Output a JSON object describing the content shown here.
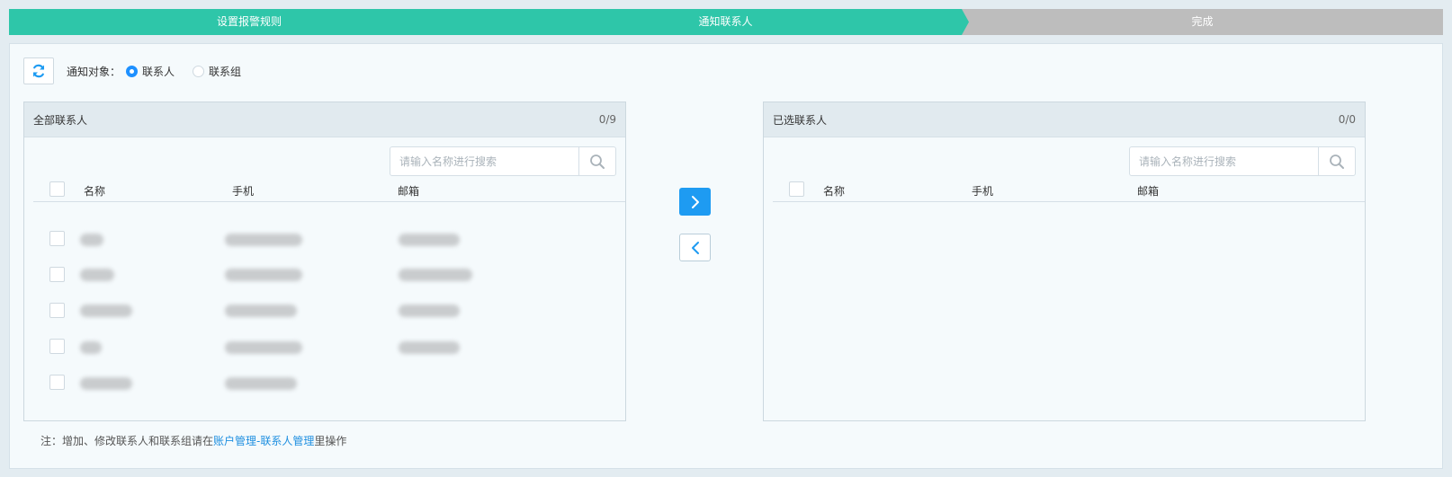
{
  "steps": [
    {
      "label": "设置报警规则",
      "state": "done",
      "color": "#2ec6a9"
    },
    {
      "label": "通知联系人",
      "state": "active",
      "color": "#2ec6a9"
    },
    {
      "label": "完成",
      "state": "pending",
      "color": "#bdbdbd"
    }
  ],
  "toolbar": {
    "refresh_icon": "refresh-icon",
    "target_label": "通知对象：",
    "options": [
      {
        "label": "联系人",
        "checked": true
      },
      {
        "label": "联系组",
        "checked": false
      }
    ]
  },
  "left_panel": {
    "title": "全部联系人",
    "count": "0/9",
    "search_placeholder": "请输入名称进行搜索",
    "columns": [
      "名称",
      "手机",
      "邮箱"
    ],
    "rows_note": "row contents are blurred / redacted"
  },
  "right_panel": {
    "title": "已选联系人",
    "count": "0/0",
    "search_placeholder": "请输入名称进行搜索",
    "columns": [
      "名称",
      "手机",
      "邮箱"
    ]
  },
  "transfer": {
    "add_icon": "chevron-right-icon",
    "remove_icon": "chevron-left-icon"
  },
  "footer": {
    "prefix": "注：增加、修改联系人和联系组请在",
    "link": "账户管理-联系人管理",
    "suffix": "里操作"
  },
  "colors": {
    "accent": "#1e9bf2",
    "step_active": "#2ec6a9",
    "step_pending": "#bdbdbd",
    "link": "#1e8fe0"
  }
}
